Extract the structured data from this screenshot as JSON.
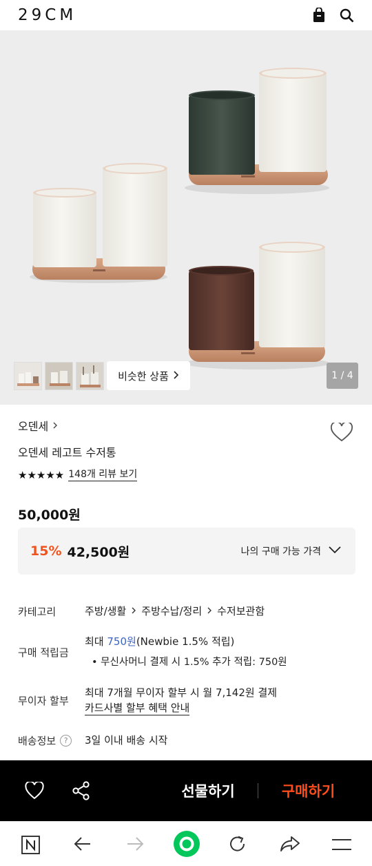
{
  "header": {
    "logo": "29CM",
    "icons": [
      "shopping-bag-icon",
      "search-icon"
    ]
  },
  "hero": {
    "counter": "1 / 4",
    "similar_label": "비슷한 상품",
    "thumbnails": [
      "thumb-1",
      "thumb-2",
      "thumb-3"
    ]
  },
  "product": {
    "brand": "오덴세",
    "name": "오덴세 레고트 수저통",
    "rating_stars": 5,
    "review_link": "148개 리뷰 보기",
    "price": "50,000원",
    "sale": {
      "percent": "15%",
      "price": "42,500원",
      "my_price_label": "나의 구매 가능 가격"
    }
  },
  "details": {
    "category": {
      "label": "카테고리",
      "path": [
        "주방/생활",
        "주방수납/정리",
        "수저보관함"
      ]
    },
    "points": {
      "label": "구매 적립금",
      "prefix": "최대 ",
      "amount": "750원",
      "suffix": "(Newbie 1.5% 적립)",
      "bullet": "무신사머니 결제 시 1.5% 추가 적립: 750원"
    },
    "installment": {
      "label": "무이자 할부",
      "text": "최대 7개월 무이자 할부 시 월 7,142원 결제",
      "link": "카드사별 할부 혜택 안내"
    },
    "shipping": {
      "label": "배송정보",
      "text": "3일 이내 배송 시작"
    }
  },
  "action_bar": {
    "gift_label": "선물하기",
    "buy_label": "구매하기"
  },
  "browser_nav": {
    "icons": [
      "naver-n-icon",
      "back-arrow-icon",
      "forward-arrow-icon",
      "home-circle-icon",
      "refresh-icon",
      "share-icon",
      "menu-icon"
    ]
  },
  "colors": {
    "accent_sale": "#f0531c",
    "buy": "#ff4d1c",
    "link_blue": "#3b63c5",
    "green": "#03c75a"
  }
}
